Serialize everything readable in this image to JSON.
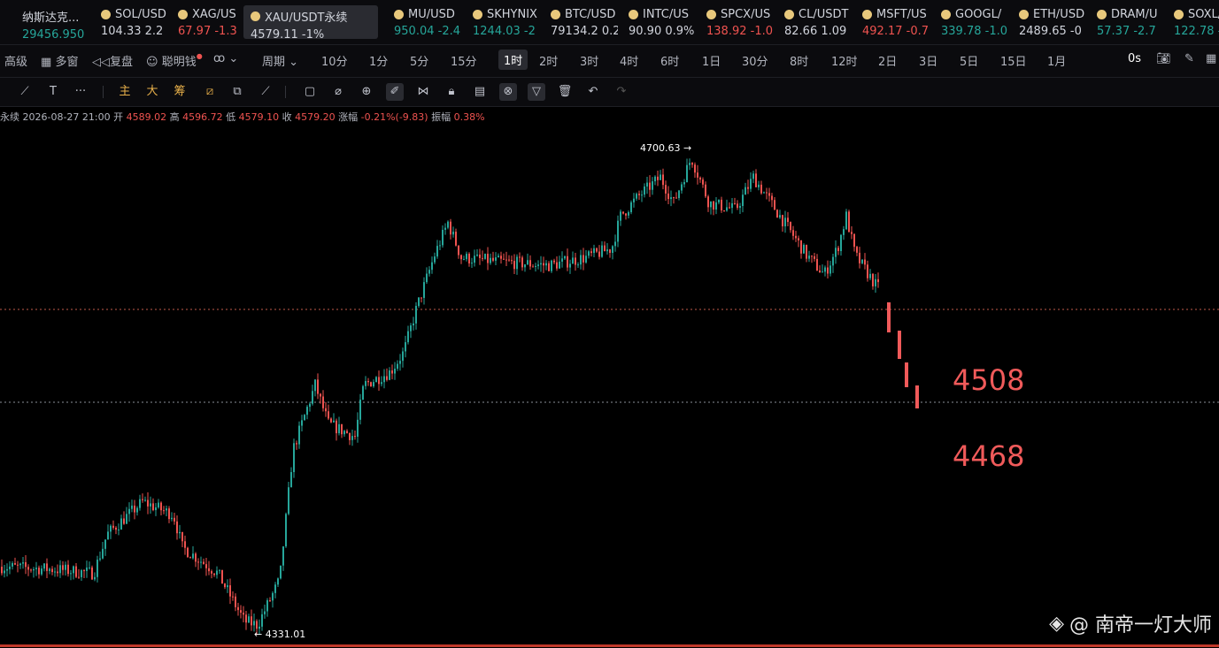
{
  "tickers": [
    {
      "name": "纳斯达克...",
      "price": "29456.950",
      "change": "",
      "dir": "up",
      "icon": false
    },
    {
      "name": "SOL/USD",
      "price": "104.33",
      "change": "2.2",
      "dir": "neu",
      "icon": true
    },
    {
      "name": "XAG/US",
      "price": "67.97",
      "change": "-1.3",
      "dir": "down",
      "icon": true
    },
    {
      "name": "XAU/USDT永续",
      "price": "4579.11",
      "change": "-1%",
      "dir": "neu",
      "icon": true,
      "active": true
    },
    {
      "name": "MU/USD",
      "price": "950.04",
      "change": "-2.4",
      "dir": "up",
      "icon": true
    },
    {
      "name": "SKHYNIX",
      "price": "1244.03",
      "change": "-2",
      "dir": "up",
      "icon": true
    },
    {
      "name": "BTC/USD",
      "price": "79134.2",
      "change": "0.2",
      "dir": "neu",
      "icon": true
    },
    {
      "name": "INTC/US",
      "price": "90.90",
      "change": "0.9%",
      "dir": "neu",
      "icon": true
    },
    {
      "name": "SPCX/US",
      "price": "138.92",
      "change": "-1.0",
      "dir": "down",
      "icon": true
    },
    {
      "name": "CL/USDT",
      "price": "82.66",
      "change": "1.09",
      "dir": "neu",
      "icon": true
    },
    {
      "name": "MSFT/US",
      "price": "492.17",
      "change": "-0.7",
      "dir": "down",
      "icon": true
    },
    {
      "name": "GOOGL/",
      "price": "339.78",
      "change": "-1.0",
      "dir": "up",
      "icon": true
    },
    {
      "name": "ETH/USD",
      "price": "2489.65",
      "change": "-0",
      "dir": "neu",
      "icon": true
    },
    {
      "name": "DRAM/U",
      "price": "57.37",
      "change": "-2.7",
      "dir": "up",
      "icon": true
    },
    {
      "name": "SOXL/",
      "price": "122.78",
      "change": "-",
      "dir": "up",
      "icon": true
    }
  ],
  "toolbar": {
    "advanced": "高级",
    "multi": "多窗",
    "replay": "复盘",
    "smart": "聪明钱",
    "period": "周期",
    "timeframes": [
      "10分",
      "1分",
      "5分",
      "15分",
      "1时",
      "2时",
      "3时",
      "4时",
      "6时",
      "1日",
      "30分",
      "8时",
      "12时",
      "2日",
      "3日",
      "5日",
      "15日",
      "1月"
    ],
    "selected": "1时",
    "countdown": "0s"
  },
  "drawtools": {
    "main": "主",
    "big": "大",
    "chip": "筹"
  },
  "ohlc": {
    "symbol": "永续",
    "datetime": "2026-08-27 21:00",
    "open_label": "开",
    "open": "4589.02",
    "high_label": "高",
    "high": "4596.72",
    "low_label": "低",
    "low": "4579.10",
    "close_label": "收",
    "close": "4579.20",
    "chg_label": "涨幅",
    "chg": "-0.21%(-9.83)",
    "amp_label": "振幅",
    "amp": "0.38%"
  },
  "annotations": {
    "high": "4700.63",
    "low": "4331.01",
    "target1": "4508",
    "target2": "4468"
  },
  "watermark": {
    "text": "@ 南帝一灯大师"
  },
  "chart_data": {
    "type": "candlestick",
    "price_range": [
      4320,
      4715
    ],
    "high": 4700.63,
    "low": 4331.01,
    "levels": [
      4560,
      4508
    ],
    "projection": [
      4560,
      4540,
      4528,
      4515
    ],
    "up_color": "#26a69a",
    "down_color": "#ef5350"
  }
}
